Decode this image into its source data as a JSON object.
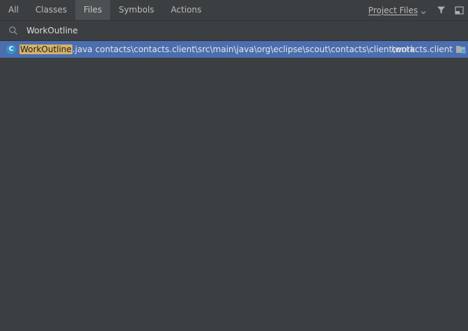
{
  "tabs": [
    {
      "label": "All",
      "active": false
    },
    {
      "label": "Classes",
      "active": false
    },
    {
      "label": "Files",
      "active": true
    },
    {
      "label": "Symbols",
      "active": false
    },
    {
      "label": "Actions",
      "active": false
    }
  ],
  "scope": {
    "label": "Project Files"
  },
  "icons": {
    "search": "search-icon",
    "filter": "filter-icon",
    "pin": "window-icon",
    "result": "class-icon",
    "folder": "folder-icon"
  },
  "search": {
    "value": "WorkOutline"
  },
  "results": [
    {
      "icon_letter": "C",
      "match": "WorkOutline",
      "extension": ".java",
      "path": "contacts\\contacts.client\\src\\main\\java\\org\\eclipse\\scout\\contacts\\client\\work",
      "module": "contacts.client"
    }
  ],
  "colors": {
    "background": "#3b3f42",
    "selection": "#4b6eaf",
    "highlight": "#d6b36a",
    "active_tab": "#4b5052"
  }
}
